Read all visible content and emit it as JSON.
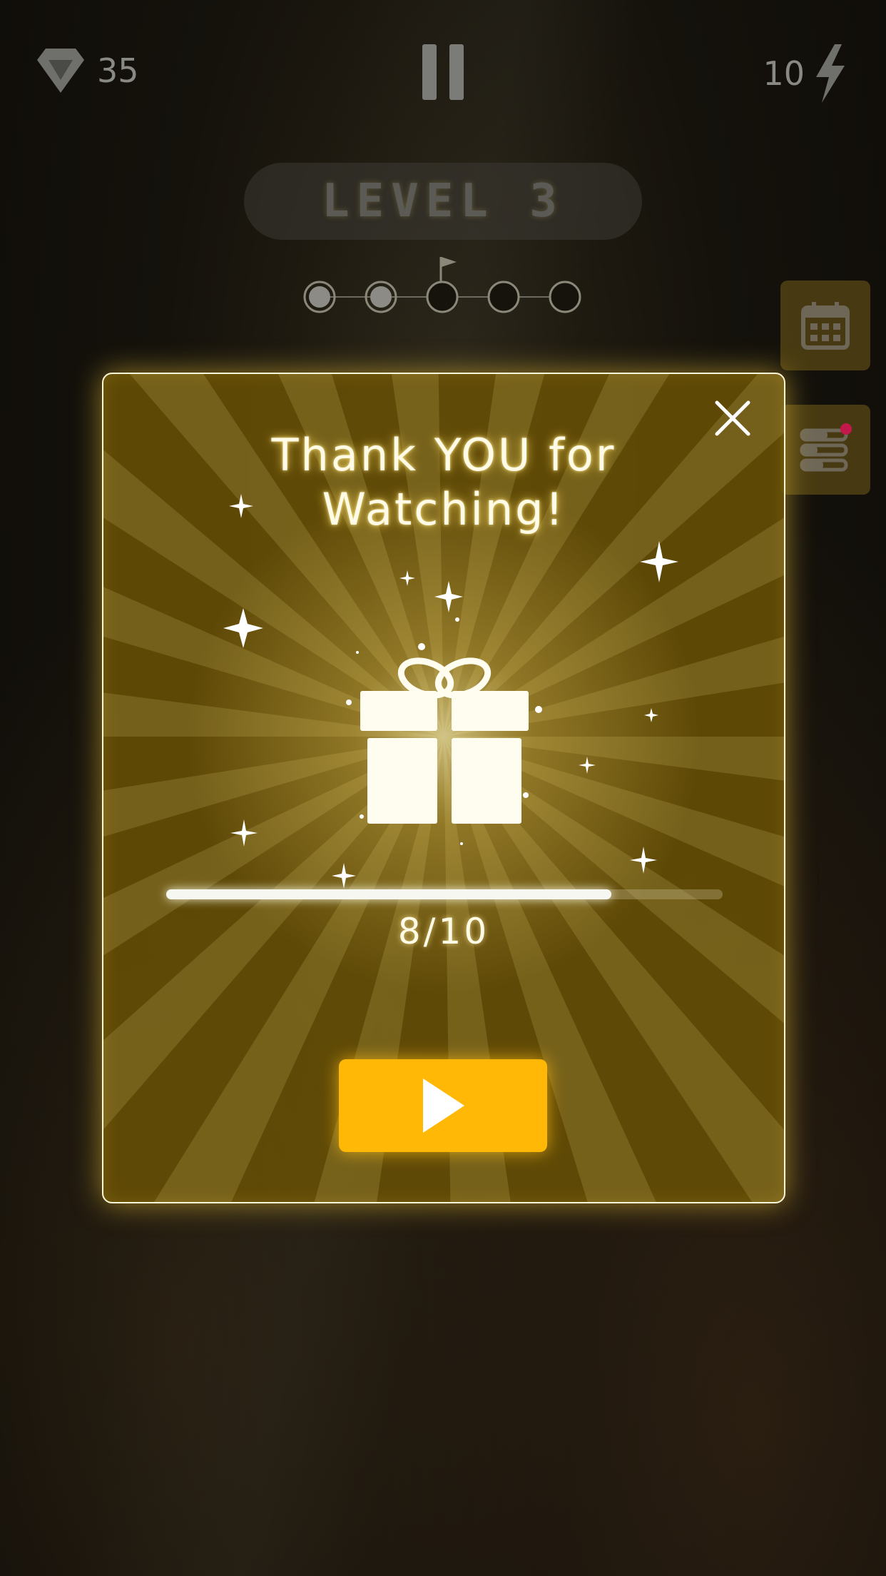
{
  "hud": {
    "gems": "35",
    "energy": "10",
    "gem_icon": "diamond-icon",
    "energy_icon": "lightning-icon",
    "pause_icon": "pause-icon"
  },
  "level": {
    "title": "LEVEL 3",
    "stages_total": 5,
    "stages_completed": 2,
    "flag_stage": 3
  },
  "side_buttons": [
    {
      "icon": "calendar-icon"
    },
    {
      "icon": "list-icon",
      "has_notification": true
    }
  ],
  "modal": {
    "title_line1": "Thank YOU for",
    "title_line2": "Watching!",
    "progress_value": 8,
    "progress_max": 10,
    "progress_label": "8/10",
    "play_icon": "play-icon",
    "close_icon": "close-icon",
    "reward_icon": "gift-icon"
  },
  "colors": {
    "modal_bg": "#685006",
    "accent": "#ffb806",
    "notification": "#c2184b"
  }
}
